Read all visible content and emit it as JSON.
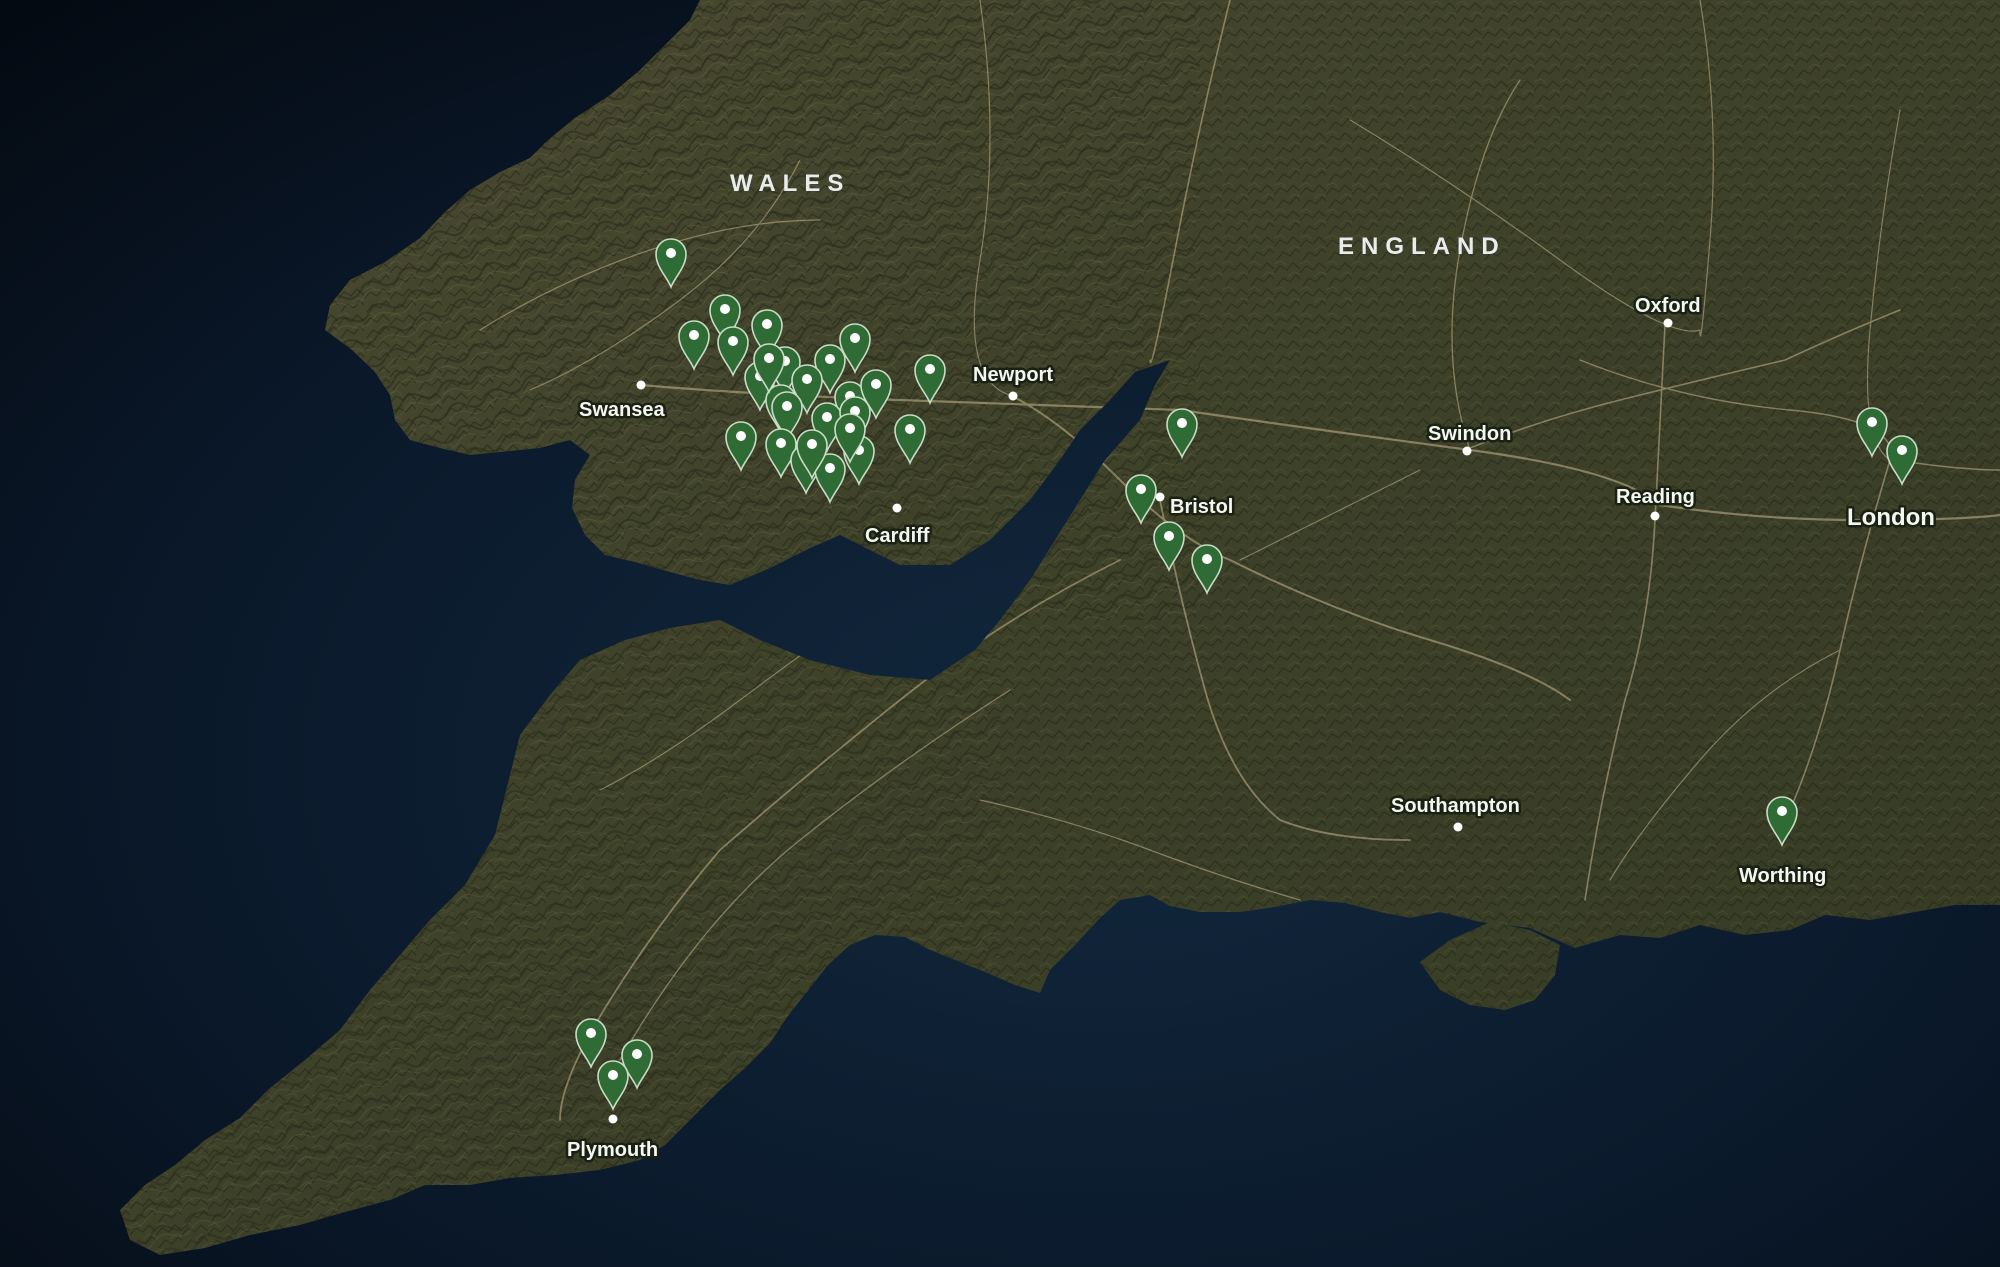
{
  "map": {
    "regions": [
      {
        "id": "wales",
        "label": "WALES"
      },
      {
        "id": "england",
        "label": "ENGLAND"
      }
    ],
    "cities": [
      {
        "id": "swansea",
        "label": "Swansea",
        "tier": "minor"
      },
      {
        "id": "cardiff",
        "label": "Cardiff",
        "tier": "minor"
      },
      {
        "id": "newport",
        "label": "Newport",
        "tier": "minor"
      },
      {
        "id": "bristol",
        "label": "Bristol",
        "tier": "minor"
      },
      {
        "id": "swindon",
        "label": "Swindon",
        "tier": "minor"
      },
      {
        "id": "oxford",
        "label": "Oxford",
        "tier": "minor"
      },
      {
        "id": "reading",
        "label": "Reading",
        "tier": "minor"
      },
      {
        "id": "london",
        "label": "London",
        "tier": "major"
      },
      {
        "id": "southampton",
        "label": "Southampton",
        "tier": "minor"
      },
      {
        "id": "worthing",
        "label": "Worthing",
        "tier": "minor"
      },
      {
        "id": "plymouth",
        "label": "Plymouth",
        "tier": "minor"
      }
    ],
    "markers": {
      "count": 36,
      "icon": "map-pin-icon",
      "color": "#2e6b35"
    },
    "colors": {
      "sea": "#0b1a2b",
      "land": "#3b3f28",
      "roads": "#c7b58f",
      "pin": "#2e6b35"
    }
  }
}
